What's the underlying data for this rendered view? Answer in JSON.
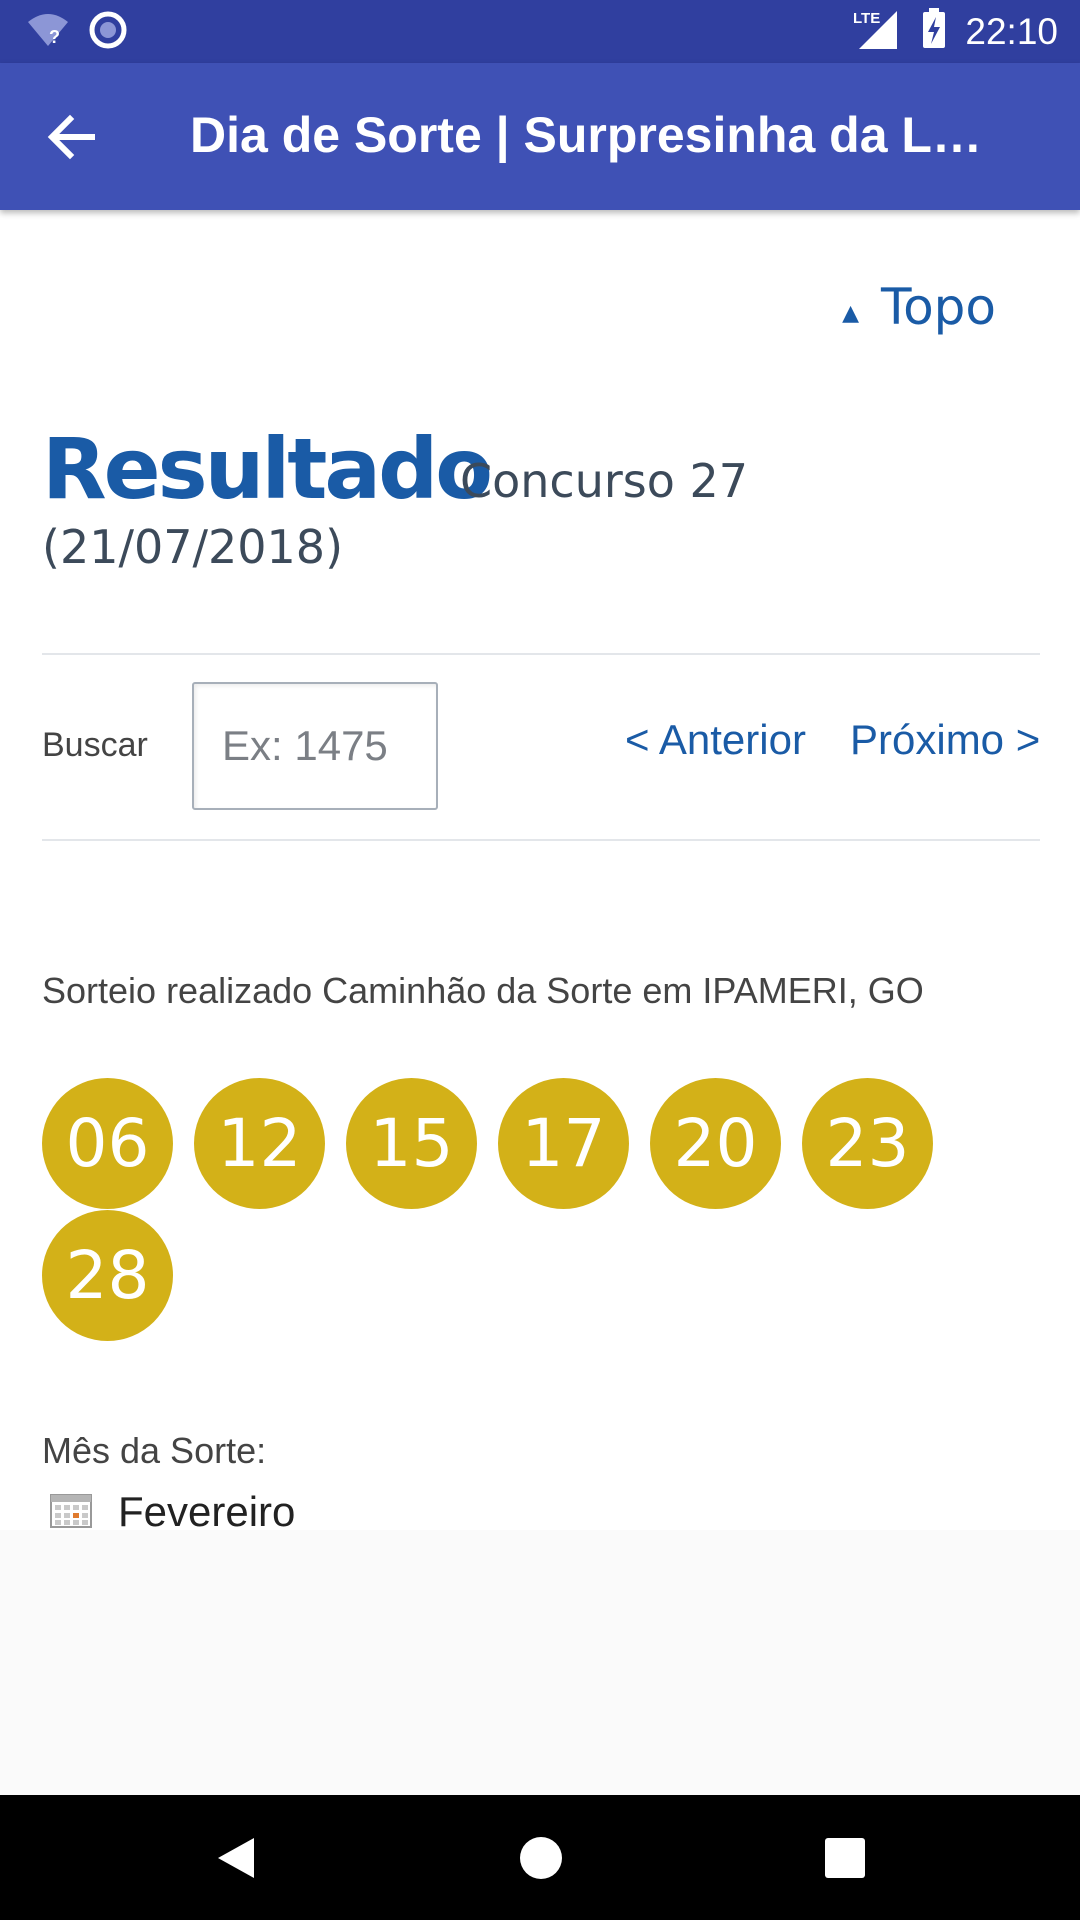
{
  "status_bar": {
    "time": "22:10",
    "network": "LTE",
    "icons": [
      "wifi-unknown-icon",
      "sync-icon",
      "signal-icon",
      "battery-charging-icon"
    ]
  },
  "app_bar": {
    "title": "Dia de Sorte | Surpresinha da Lot…",
    "back_icon": "arrow-left-icon"
  },
  "content": {
    "topo_label": "Topo",
    "topo_icon": "triangle-up",
    "result_title": "Resultado",
    "concurso": "Concurso 27",
    "date": "(21/07/2018)",
    "search": {
      "label": "Buscar",
      "placeholder": "Ex: 1475",
      "value": ""
    },
    "nav": {
      "prev": "< Anterior",
      "next": "Próximo >"
    },
    "sorteio_text": "Sorteio realizado Caminhão da Sorte em IPAMERI, GO",
    "numbers": [
      "06",
      "12",
      "15",
      "17",
      "20",
      "23",
      "28"
    ],
    "mes_label": "Mês da Sorte:",
    "mes_value": "Fevereiro",
    "mes_icon": "calendar-icon"
  },
  "colors": {
    "status_bar": "#303f9f",
    "app_bar": "#3f51b5",
    "accent": "#1a5ba6",
    "ball": "#d3b118"
  },
  "nav_bar": {
    "buttons": [
      "back-triangle-icon",
      "home-circle-icon",
      "recents-square-icon"
    ]
  }
}
